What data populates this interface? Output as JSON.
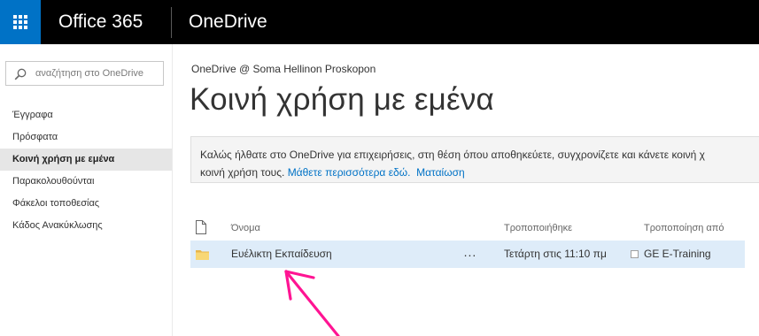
{
  "suite": {
    "title": "Office 365",
    "app_title": "OneDrive"
  },
  "search": {
    "placeholder": "αναζήτηση στο OneDrive"
  },
  "nav": {
    "items": [
      {
        "label": "Έγγραφα",
        "selected": false
      },
      {
        "label": "Πρόσφατα",
        "selected": false
      },
      {
        "label": "Κοινή χρήση με εμένα",
        "selected": true
      },
      {
        "label": "Παρακολουθούνται",
        "selected": false
      },
      {
        "label": "Φάκελοι τοποθεσίας",
        "selected": false
      },
      {
        "label": "Κάδος Ανακύκλωσης",
        "selected": false
      }
    ]
  },
  "main": {
    "breadcrumb": "OneDrive @ Soma Hellinon Proskopon",
    "title": "Κοινή χρήση με εμένα",
    "banner": {
      "line1": "Καλώς ήλθατε στο OneDrive για επιχειρήσεις, στη θέση όπου αποθηκεύετε, συγχρονίζετε και κάνετε κοινή χ",
      "line2_text": "κοινή χρήση τους.",
      "learn_more": "Μάθετε περισσότερα εδώ.",
      "dismiss": "Ματαίωση"
    }
  },
  "file_list": {
    "columns": {
      "name": "Όνομα",
      "modified": "Τροποποιήθηκε",
      "modified_by": "Τροποποίηση από"
    },
    "rows": [
      {
        "name": "Ευέλικτη Εκπαίδευση",
        "more": "...",
        "modified": "Τετάρτη στις 11:10 πμ",
        "modified_by": "GE E-Training",
        "type": "folder"
      }
    ]
  },
  "colors": {
    "suite_bar": "#000000",
    "waffle": "#0072c6",
    "link": "#0072c6",
    "row_highlight": "#deecf9",
    "folder": "#f8d775",
    "annotation_arrow": "#ff1493"
  },
  "icons": {
    "waffle": "waffle-icon",
    "search": "search-icon",
    "document": "document-icon",
    "folder": "folder-icon"
  }
}
